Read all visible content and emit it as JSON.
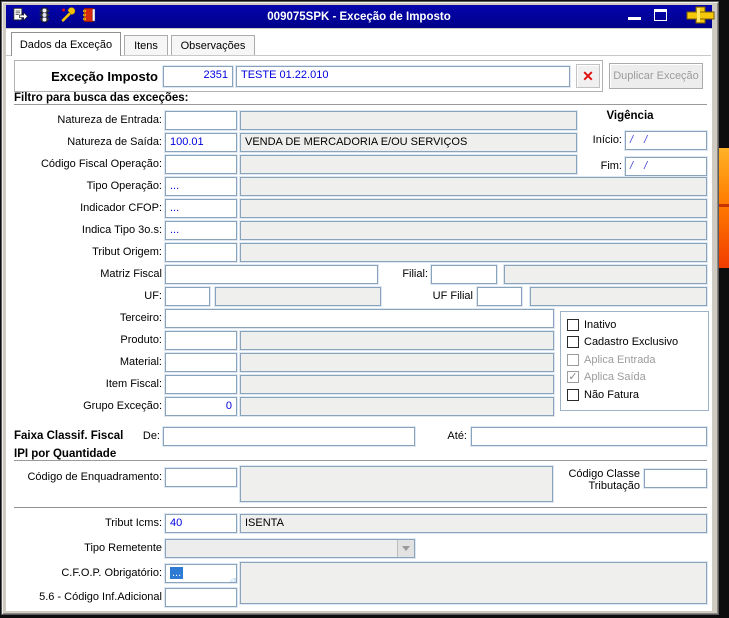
{
  "colors": {
    "titlebar": "#000089",
    "value_blue": "#0000e0",
    "date_blue": "#4646d8",
    "orange_bar": "#ff7d00",
    "readonly_bg": "#efefee",
    "field_border": "#8aa3bc",
    "selection": "#2e7bd6",
    "clear_red": "#e01010"
  },
  "titlebar": {
    "title": "009075SPK - Exceção de Imposto",
    "icons": [
      "report-icon",
      "traffic-light-icon",
      "wrench-icon",
      "book-icon"
    ]
  },
  "tabs": [
    {
      "label": "Dados da Exceção",
      "active": true
    },
    {
      "label": "Itens",
      "active": false
    },
    {
      "label": "Observações",
      "active": false
    }
  ],
  "header": {
    "label": "Exceção Imposto",
    "code": "2351",
    "name": "TESTE 01.22.010",
    "clear": "✕",
    "duplicate": "Duplicar Exceção"
  },
  "sections": {
    "filtro": "Filtro para busca das exceções:",
    "faixa": "Faixa Classif. Fiscal",
    "ipi": "IPI por Quantidade"
  },
  "vigencia": {
    "title": "Vigência",
    "inicio_label": "Início:",
    "inicio_value": "/ /",
    "fim_label": "Fim:",
    "fim_value": "/ /"
  },
  "filtro": {
    "natureza_entrada": {
      "label": "Natureza de Entrada:",
      "value": "",
      "desc": ""
    },
    "natureza_saida": {
      "label": "Natureza de Saída:",
      "value": "100.01",
      "desc": "VENDA DE MERCADORIA E/OU SERVIÇOS"
    },
    "codigo_fiscal": {
      "label": "Código Fiscal Operação:",
      "value": "",
      "desc": ""
    },
    "tipo_operacao": {
      "label": "Tipo Operação:",
      "value": "...",
      "desc": ""
    },
    "indicador_cfop": {
      "label": "Indicador CFOP:",
      "value": "...",
      "desc": ""
    },
    "indica_tipo_3os": {
      "label": "Indica Tipo 3o.s:",
      "value": "...",
      "desc": ""
    },
    "tribut_origem": {
      "label": "Tribut Origem:",
      "value": "",
      "desc": ""
    },
    "matriz_fiscal": {
      "label": "Matriz Fiscal",
      "value": ""
    },
    "filial": {
      "label": "Filial:",
      "value": "",
      "desc": ""
    },
    "uf": {
      "label": "UF:",
      "value": "",
      "desc": ""
    },
    "uf_filial": {
      "label": "UF Filial",
      "value": "",
      "desc": ""
    },
    "terceiro": {
      "label": "Terceiro:",
      "value": ""
    },
    "produto": {
      "label": "Produto:",
      "value": "",
      "desc": ""
    },
    "material": {
      "label": "Material:",
      "value": "",
      "desc": ""
    },
    "item_fiscal": {
      "label": "Item Fiscal:",
      "value": "",
      "desc": ""
    },
    "grupo_excecao": {
      "label": "Grupo Exceção:",
      "value": "0",
      "desc": ""
    }
  },
  "checkbox_group": {
    "items": [
      {
        "label": "Inativo",
        "checked": false,
        "disabled": false
      },
      {
        "label": "Cadastro Exclusivo",
        "checked": false,
        "disabled": false
      },
      {
        "label": "Aplica Entrada",
        "checked": false,
        "disabled": true
      },
      {
        "label": "Aplica Saída",
        "checked": true,
        "disabled": true
      },
      {
        "label": "Não Fatura",
        "checked": false,
        "disabled": false
      }
    ]
  },
  "faixa": {
    "de_label": "De:",
    "de_value": "",
    "ate_label": "Até:",
    "ate_value": ""
  },
  "ipi": {
    "enquadramento_label": "Código de Enquadramento:",
    "enquadramento_value": "",
    "enquadramento_desc": "",
    "classe_line1": "Código Classe",
    "classe_line2": "Tributação",
    "classe_value": ""
  },
  "bottom": {
    "tribut_icms": {
      "label": "Tribut Icms:",
      "value": "40",
      "desc": "ISENTA"
    },
    "tipo_remetente": {
      "label": "Tipo Remetente",
      "value": ""
    },
    "cfop_obrigatorio": {
      "label": "C.F.O.P. Obrigatório:",
      "value": "...",
      "desc": ""
    },
    "cod_inf_adicional": {
      "label": "5.6 - Código Inf.Adicional",
      "value": ""
    }
  }
}
